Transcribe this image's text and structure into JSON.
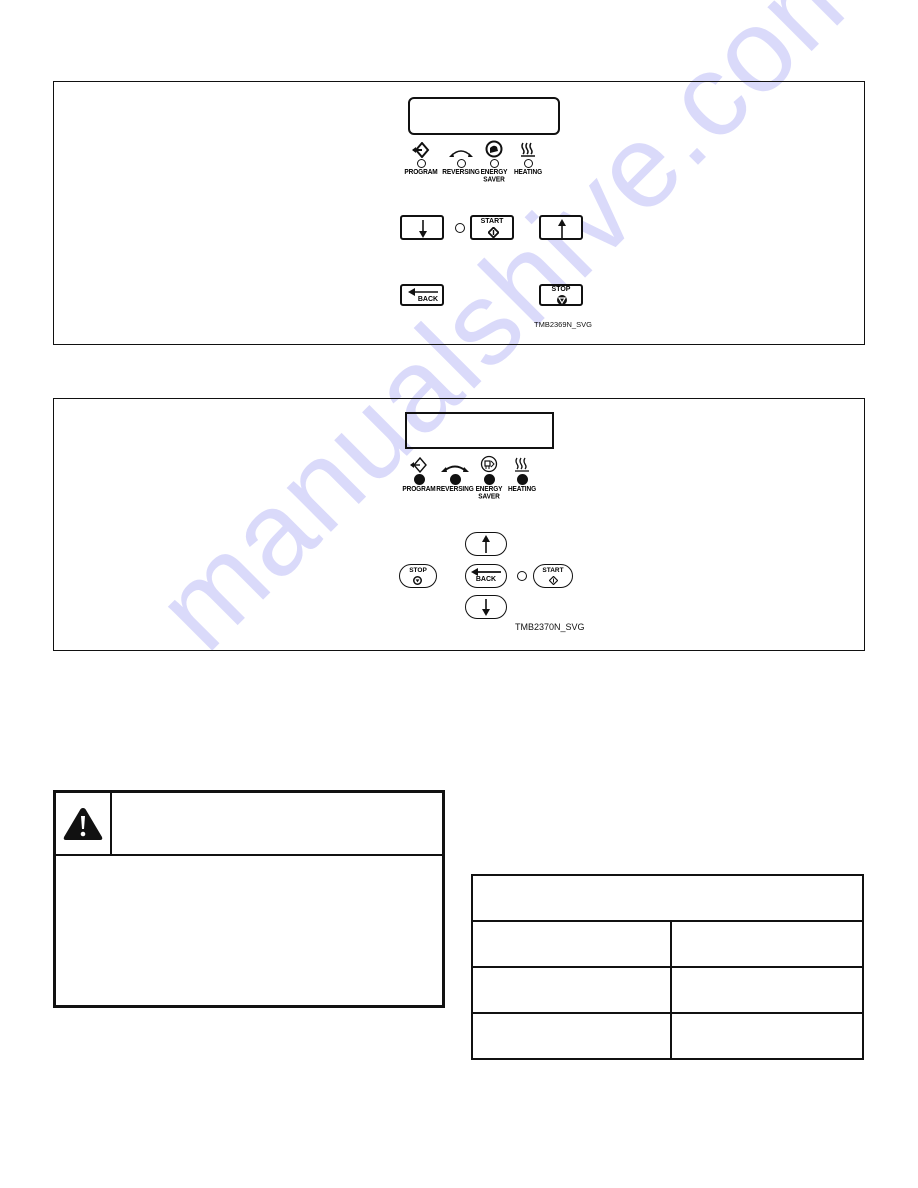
{
  "figures": [
    {
      "id": "panel1",
      "code": "TMB2369N_SVG",
      "display_text": "",
      "indicators": [
        {
          "icon": "program-icon",
          "label": "PROGRAM",
          "led": "off"
        },
        {
          "icon": "reversing-icon",
          "label": "REVERSING",
          "led": "off"
        },
        {
          "icon": "energy-saver-icon",
          "label": "ENERGY SAVER",
          "led": "off"
        },
        {
          "icon": "heating-icon",
          "label": "HEATING",
          "led": "off"
        }
      ],
      "buttons": {
        "down": {
          "label": "",
          "icon": "arrow-down-icon"
        },
        "start": {
          "label": "START",
          "icon": "start-diamond-icon"
        },
        "up": {
          "label": "",
          "icon": "arrow-up-icon"
        },
        "back": {
          "label": "BACK",
          "icon": "arrow-left-icon"
        },
        "stop": {
          "label": "STOP",
          "icon": "stop-icon"
        }
      }
    },
    {
      "id": "panel2",
      "code": "TMB2370N_SVG",
      "display_text": "",
      "indicators": [
        {
          "icon": "program-icon",
          "label": "PROGRAM",
          "led": "on"
        },
        {
          "icon": "reversing-icon",
          "label": "REVERSING",
          "led": "on"
        },
        {
          "icon": "energy-saver-icon",
          "label": "ENERGY SAVER",
          "led": "on"
        },
        {
          "icon": "heating-icon",
          "label": "HEATING",
          "led": "on"
        }
      ],
      "buttons": {
        "up": {
          "label": "",
          "icon": "arrow-up-icon"
        },
        "stop": {
          "label": "STOP",
          "icon": "stop-icon"
        },
        "back": {
          "label": "BACK",
          "icon": "arrow-left-icon"
        },
        "start": {
          "label": "START",
          "icon": "start-diamond-icon"
        },
        "down": {
          "label": "",
          "icon": "arrow-down-icon"
        }
      }
    }
  ],
  "warning": {
    "icon": "warning-triangle-icon",
    "title": "",
    "body": ""
  },
  "table": {
    "header": "",
    "rows": [
      [
        "",
        ""
      ],
      [
        "",
        ""
      ],
      [
        "",
        ""
      ]
    ]
  },
  "watermark": "manualshive.com"
}
